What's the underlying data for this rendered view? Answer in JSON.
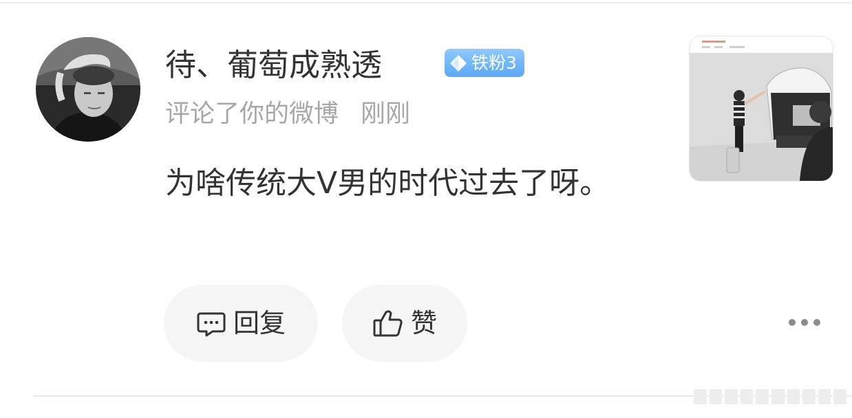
{
  "notification": {
    "user": {
      "name": "待、葡萄成熟透",
      "badge": "铁粉3"
    },
    "action": "评论了你的微博",
    "time": "刚刚",
    "comment": "为啥传统大V男的时代过去了呀。",
    "actions": {
      "reply_label": "回复",
      "like_label": "赞"
    },
    "icons": {
      "badge": "diamond-icon",
      "reply": "comment-icon",
      "like": "thumbs-up-icon",
      "more": "more-icon"
    },
    "colors": {
      "badge_blue": "#6cb4ff",
      "text_primary": "#333333",
      "text_secondary": "#a7a7a7",
      "pill_bg": "#f5f5f5"
    }
  }
}
